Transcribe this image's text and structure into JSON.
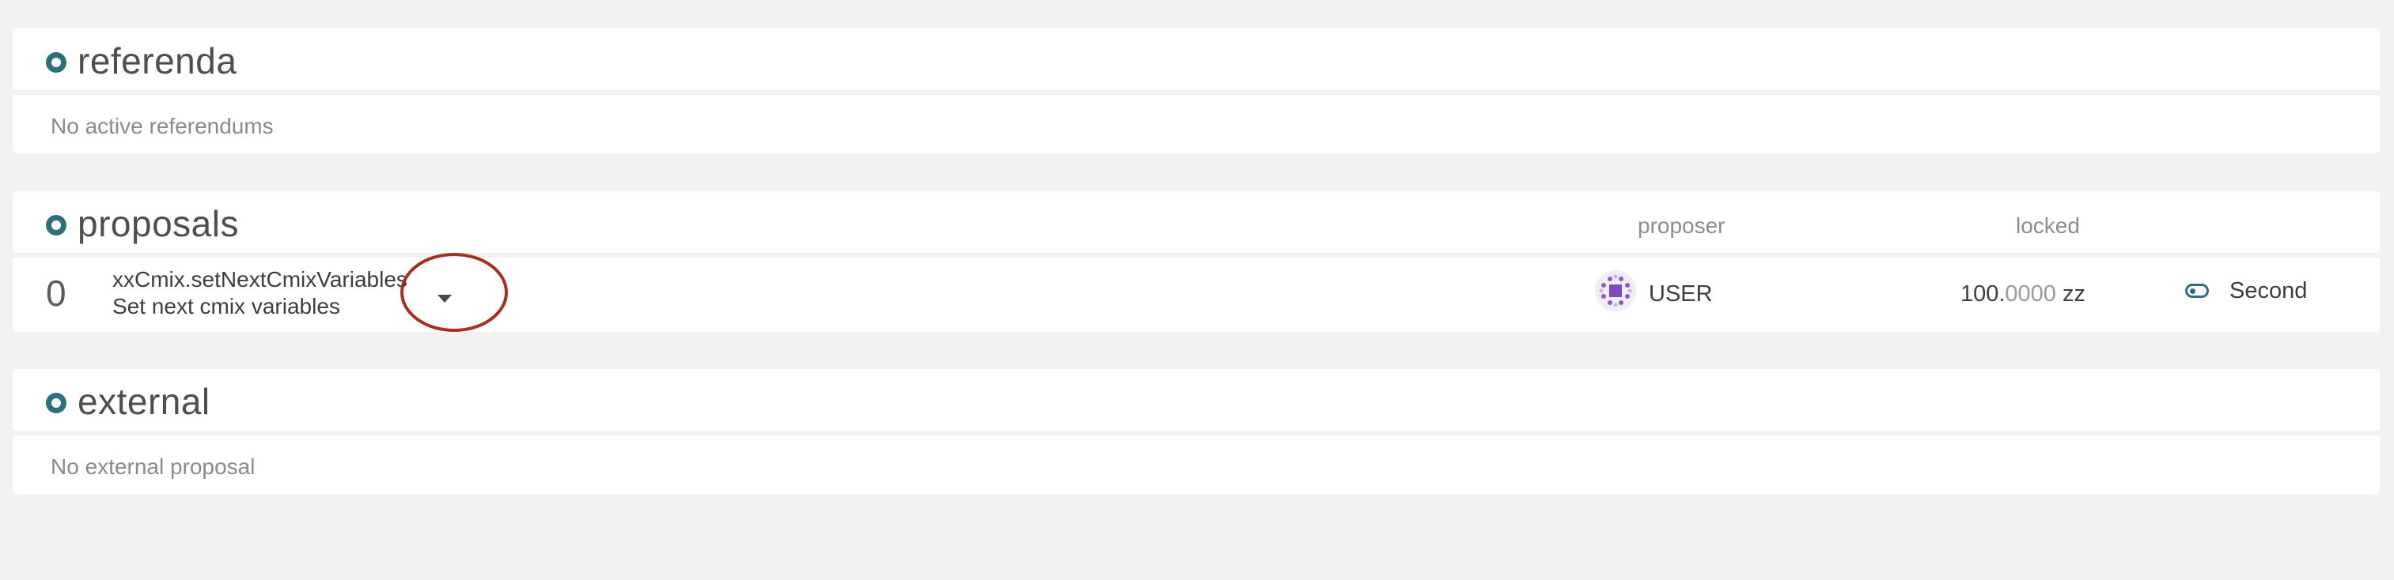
{
  "referenda": {
    "title": "referenda",
    "empty_text": "No active referendums"
  },
  "proposals": {
    "title": "proposals",
    "columns": {
      "proposer": "proposer",
      "locked": "locked"
    },
    "rows": [
      {
        "index": "0",
        "call": "xxCmix.setNextCmixVariables",
        "description": "Set next cmix variables",
        "proposer": "USER",
        "locked_int": "100.",
        "locked_dec": "0000",
        "locked_unit": " zz",
        "action_label": "Second"
      }
    ]
  },
  "external": {
    "title": "external",
    "empty_text": "No external proposal"
  },
  "colors": {
    "accent": "#2d6f7f",
    "highlight": "#a5301f",
    "background": "#f3f2f0"
  },
  "icons": {
    "section_bullet": "circle-bullet-icon",
    "expand": "caret-down-icon",
    "proposer_avatar": "identicon",
    "second": "toggle-icon"
  }
}
